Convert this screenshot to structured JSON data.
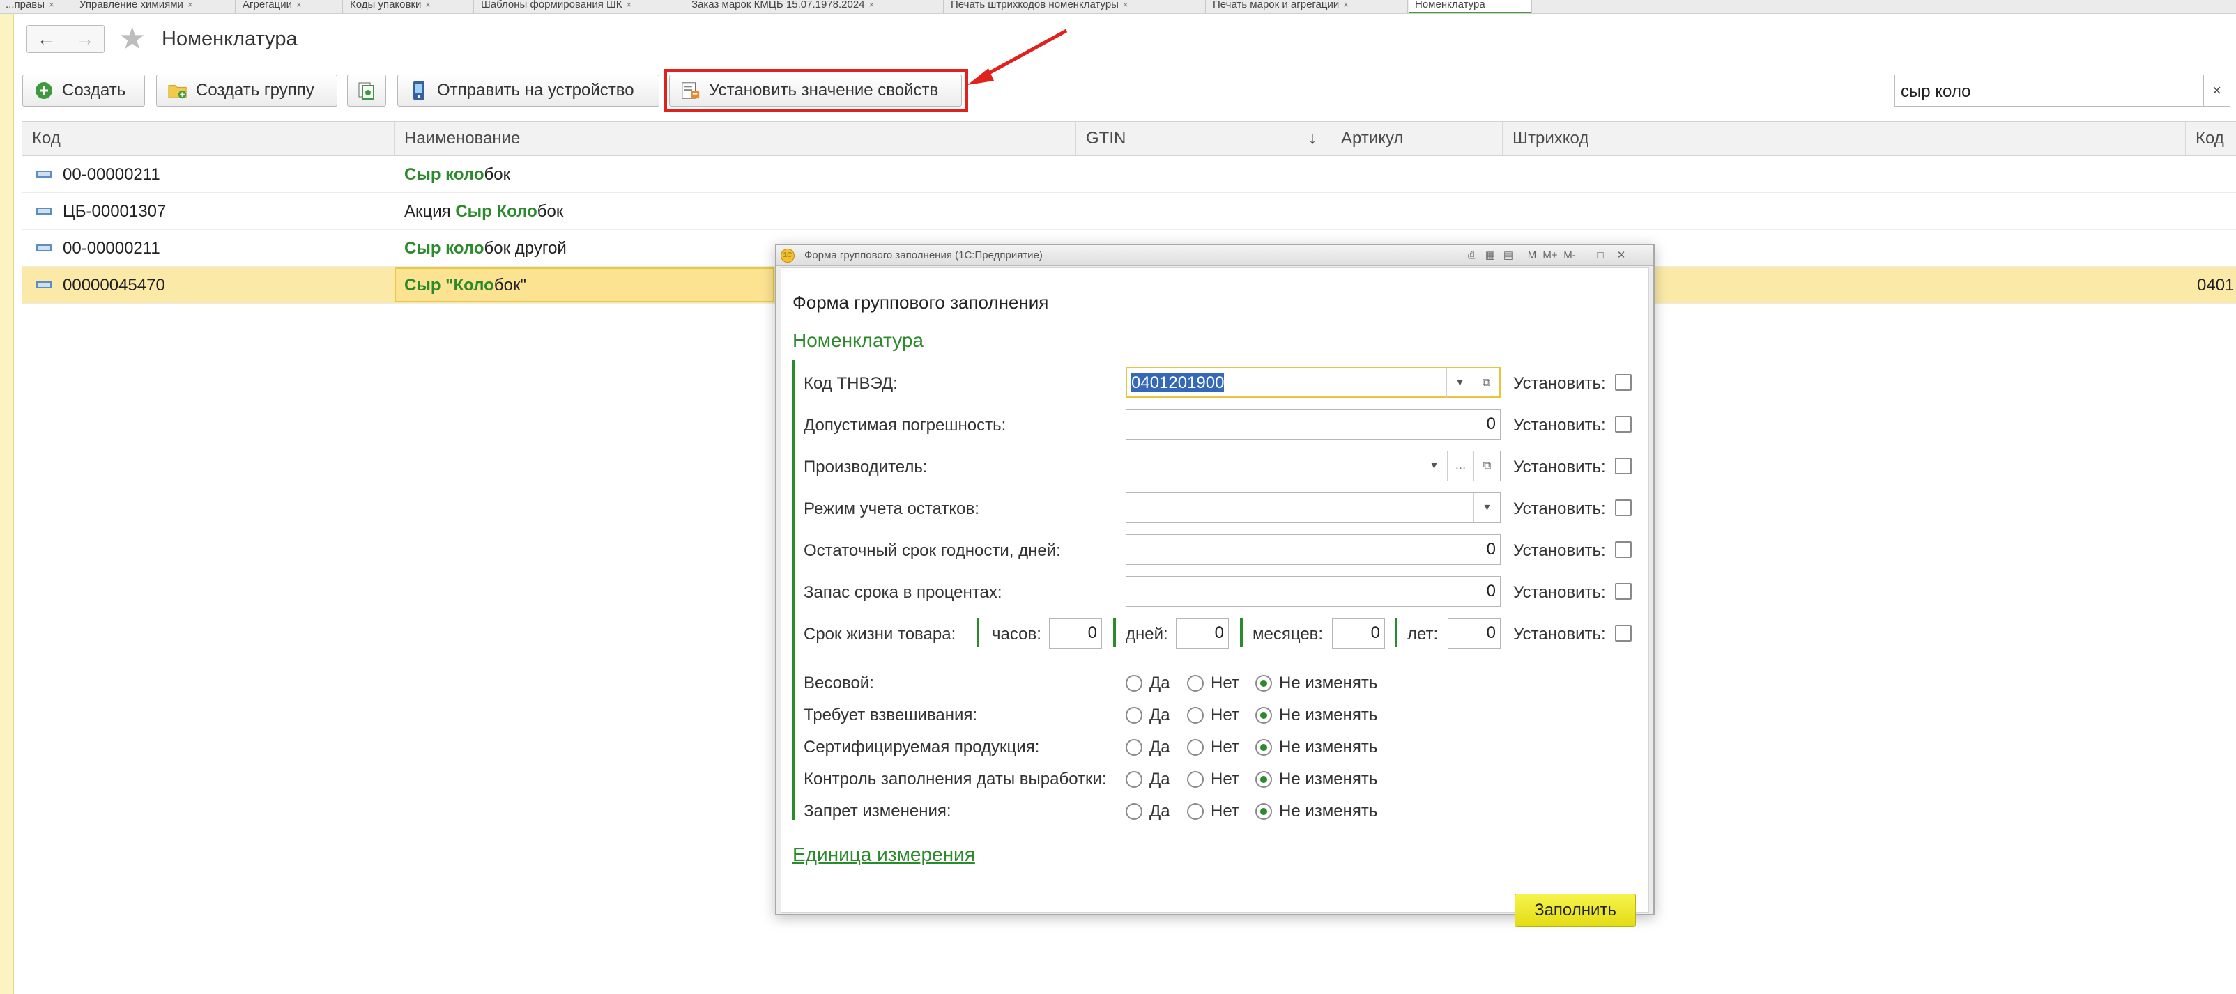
{
  "tabs": [
    {
      "label": "...правы",
      "close": "×"
    },
    {
      "label": "Управление химиями",
      "close": "×"
    },
    {
      "label": "Агрегации",
      "close": "×"
    },
    {
      "label": "Коды упаковки",
      "close": "×"
    },
    {
      "label": "Шаблоны формирования ШК",
      "close": "×"
    },
    {
      "label": "Заказ марок КМЦБ 15.07.1978.2024",
      "close": "×"
    },
    {
      "label": "Печать штрихкодов номенклатуры",
      "close": "×"
    },
    {
      "label": "Печать марок и агрегации",
      "close": "×"
    },
    {
      "label": "Номенклатура",
      "close": ""
    }
  ],
  "header": {
    "title": "Номенклатура"
  },
  "toolbar": {
    "create": "Создать",
    "create_group": "Создать группу",
    "send_to_device": "Отправить на устройство",
    "set_properties": "Установить значение свойств"
  },
  "search": {
    "value": "сыр коло",
    "clear": "×"
  },
  "table": {
    "columns": [
      "Код",
      "Наименование",
      "GTIN",
      "Артикул",
      "Штрихкод",
      "Код"
    ],
    "sort_arrow": "↓",
    "rows": [
      {
        "code": "00-00000211",
        "name_pre": "",
        "name_hl": "Сыр коло",
        "name_post": "бок",
        "tail": ""
      },
      {
        "code": "ЦБ-00001307",
        "name_pre": "Акция  ",
        "name_hl": "Сыр Коло",
        "name_post": "бок",
        "tail": ""
      },
      {
        "code": "00-00000211",
        "name_pre": "",
        "name_hl": "Сыр коло",
        "name_post": "бок другой",
        "tail": ""
      },
      {
        "code": "00000045470",
        "name_pre": "",
        "name_hl": "Сыр \"Коло",
        "name_post": "бок\"",
        "tail": "0401"
      }
    ]
  },
  "dialog": {
    "window_title": "Форма группового заполнения  (1С:Предприятие)",
    "heading": "Форма группового заполнения",
    "section": "Номенклатура",
    "set_label": "Установить:",
    "fields": {
      "tnved": {
        "label": "Код ТНВЭД:",
        "value": "0401201900"
      },
      "tolerance": {
        "label": "Допустимая погрешность:",
        "value": "0"
      },
      "manufacturer": {
        "label": "Производитель:",
        "value": ""
      },
      "stock_mode": {
        "label": "Режим учета остатков:",
        "value": ""
      },
      "shelf_life": {
        "label": "Остаточный срок годности, дней:",
        "value": "0"
      },
      "reserve_pct": {
        "label": "Запас срока в процентах:",
        "value": "0"
      }
    },
    "lifetime": {
      "label": "Срок жизни товара:",
      "hours_label": "часов:",
      "hours": "0",
      "days_label": "дней:",
      "days": "0",
      "months_label": "месяцев:",
      "months": "0",
      "years_label": "лет:",
      "years": "0"
    },
    "radio_options": {
      "yes": "Да",
      "no": "Нет",
      "keep": "Не изменять"
    },
    "radio_rows": [
      {
        "label": "Весовой:",
        "selected": "keep"
      },
      {
        "label": "Требует взвешивания:",
        "selected": "keep"
      },
      {
        "label": "Сертифицируемая продукция:",
        "selected": "keep"
      },
      {
        "label": "Контроль заполнения даты выработки:",
        "selected": "keep"
      },
      {
        "label": "Запрет изменения:",
        "selected": "keep"
      }
    ],
    "unit_link": "Единица измерения",
    "fill_button": "Заполнить"
  },
  "colors": {
    "accent_green": "#2b8a2b",
    "highlight_red": "#e0221f",
    "fill_yellow": "#efe82c"
  }
}
